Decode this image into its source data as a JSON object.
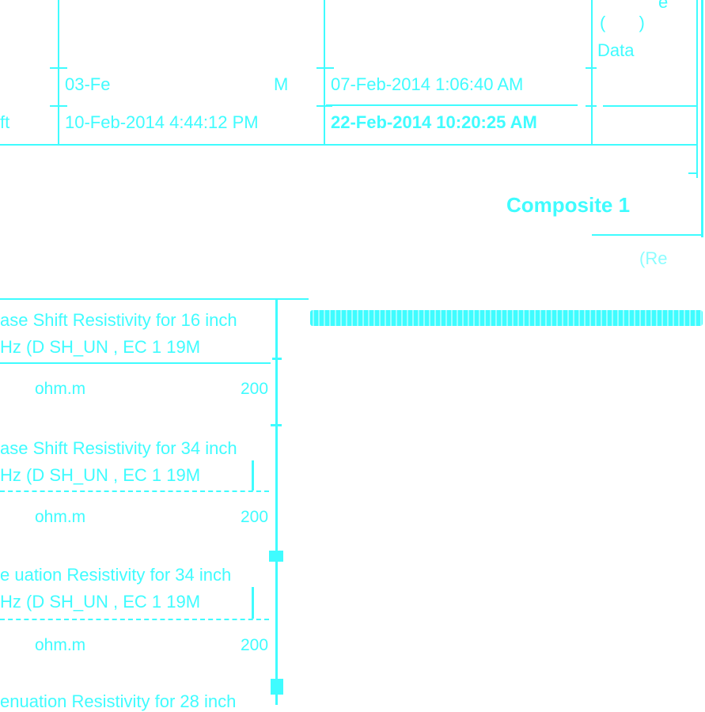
{
  "header_table": {
    "right_label_top": "e",
    "right_label_mid": "( )",
    "right_label_data": "Data",
    "row1": {
      "col1": "03-Fe",
      "col1_suffix": "M",
      "col2": "07-Feb-2014 1:06:40 AM"
    },
    "row2": {
      "left_stub": "ft",
      "col1": "10-Feb-2014 4:44:12 PM",
      "col2": "22-Feb-2014 10:20:25 AM"
    }
  },
  "composite_title": "Composite 1",
  "caption_fragment": "(Re",
  "tracks": [
    {
      "line1": "ase Shift Resistivity for 16 inch",
      "line2": "Hz (D SH_UN , EC 1 19M",
      "unit": "ohm.m",
      "scale_max": "200"
    },
    {
      "line1": "ase Shift Resistivity for 34 inch",
      "line2": "Hz (D SH_UN , EC 1 19M",
      "unit": "ohm.m",
      "scale_max": "200"
    },
    {
      "line1": "e uation Resistivity for 34 inch",
      "line2": "Hz (D SH_UN , EC 1 19M",
      "unit": "ohm.m",
      "scale_max": "200"
    },
    {
      "line1": "enuation Resistivity for 28 inch"
    }
  ],
  "colors": {
    "ink": "#3ffcff",
    "background": "#ffffff"
  }
}
